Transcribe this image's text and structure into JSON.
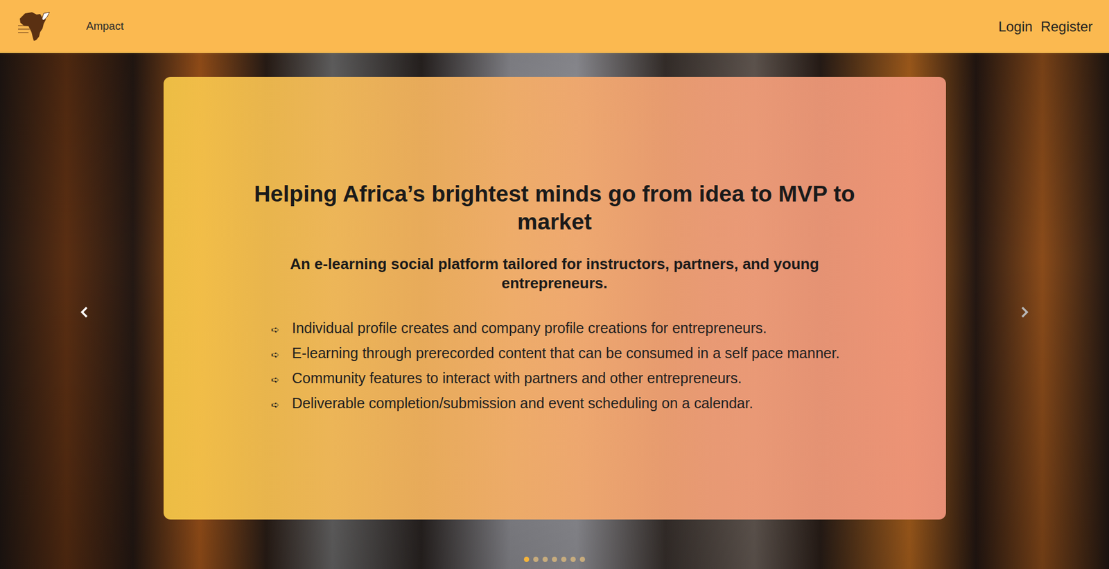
{
  "header": {
    "brand": "Ampact",
    "nav": [
      "Login",
      "Register"
    ]
  },
  "carousel": {
    "title": "Helping Africa’s brightest minds go from idea to MVP to market",
    "subtitle": "An e-learning social platform tailored for instructors, partners, and young entrepreneurs.",
    "bullet_icon": "➪",
    "bullets": [
      "Individual profile creates and company profile creations for entrepreneurs.",
      "E-learning through prerecorded content that can be consumed in a self pace manner.",
      "Community features to interact with partners and other entrepreneurs.",
      "Deliverable completion/submission and event scheduling on a calendar."
    ],
    "slides": [
      {
        "selected": true
      },
      {
        "selected": false
      },
      {
        "selected": false
      },
      {
        "selected": false
      },
      {
        "selected": false
      },
      {
        "selected": false
      },
      {
        "selected": false
      }
    ]
  }
}
